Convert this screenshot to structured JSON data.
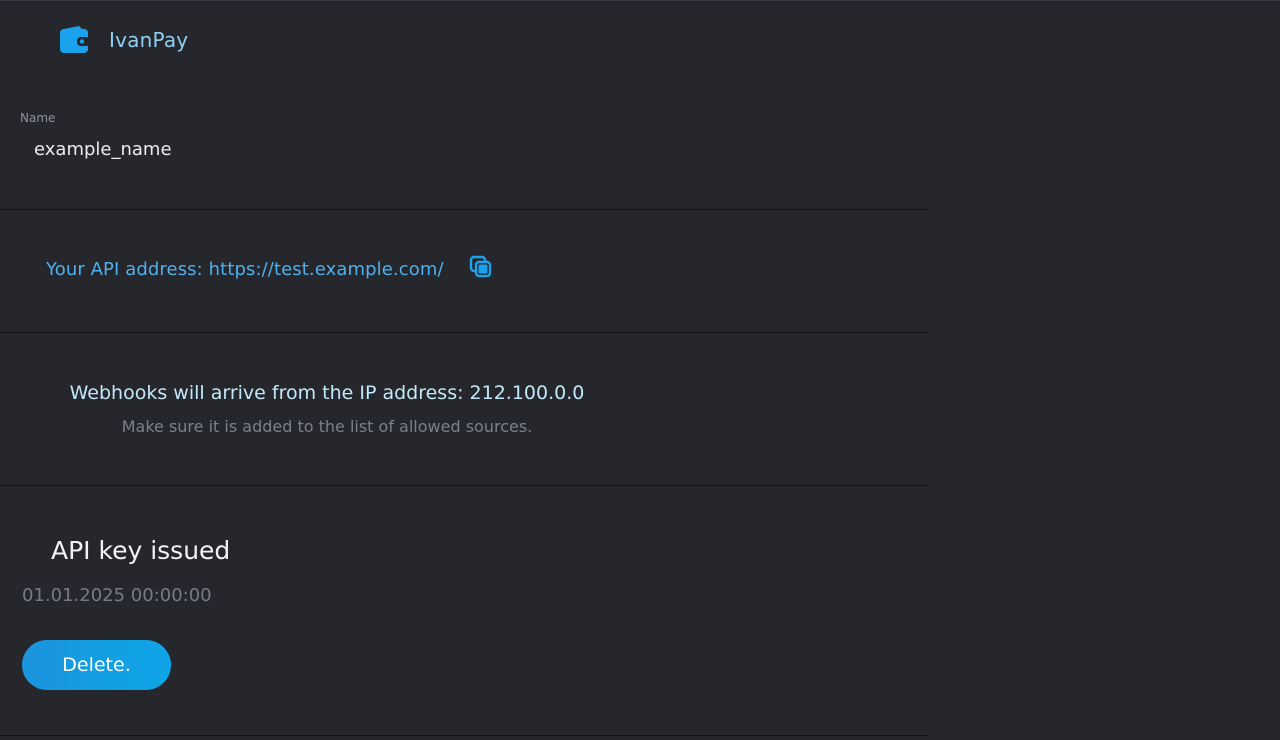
{
  "brand": {
    "name": "IvanPay",
    "icon": "wallet-icon",
    "accent_color": "#1aa3ec"
  },
  "name_field": {
    "label": "Name",
    "value": "example_name"
  },
  "api_address": {
    "text": "Your API address: https://test.example.com/",
    "copy_icon": "copy-icon"
  },
  "webhooks": {
    "title": "Webhooks will arrive from the IP address: 212.100.0.0",
    "subtitle": "Make sure it is added to the list of allowed sources."
  },
  "api_key": {
    "title": "API key issued",
    "date": "01.01.2025 00:00:00",
    "delete_label": "Delete."
  }
}
